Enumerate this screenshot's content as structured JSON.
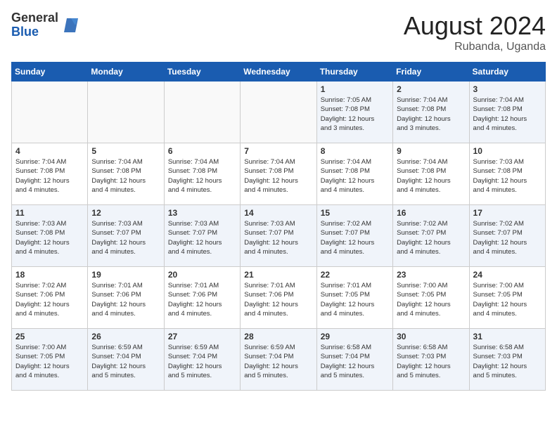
{
  "logo": {
    "general": "General",
    "blue": "Blue"
  },
  "title": {
    "month": "August 2024",
    "location": "Rubanda, Uganda"
  },
  "weekdays": [
    "Sunday",
    "Monday",
    "Tuesday",
    "Wednesday",
    "Thursday",
    "Friday",
    "Saturday"
  ],
  "weeks": [
    [
      {
        "day": "",
        "info": ""
      },
      {
        "day": "",
        "info": ""
      },
      {
        "day": "",
        "info": ""
      },
      {
        "day": "",
        "info": ""
      },
      {
        "day": "1",
        "info": "Sunrise: 7:05 AM\nSunset: 7:08 PM\nDaylight: 12 hours\nand 3 minutes."
      },
      {
        "day": "2",
        "info": "Sunrise: 7:04 AM\nSunset: 7:08 PM\nDaylight: 12 hours\nand 3 minutes."
      },
      {
        "day": "3",
        "info": "Sunrise: 7:04 AM\nSunset: 7:08 PM\nDaylight: 12 hours\nand 4 minutes."
      }
    ],
    [
      {
        "day": "4",
        "info": "Sunrise: 7:04 AM\nSunset: 7:08 PM\nDaylight: 12 hours\nand 4 minutes."
      },
      {
        "day": "5",
        "info": "Sunrise: 7:04 AM\nSunset: 7:08 PM\nDaylight: 12 hours\nand 4 minutes."
      },
      {
        "day": "6",
        "info": "Sunrise: 7:04 AM\nSunset: 7:08 PM\nDaylight: 12 hours\nand 4 minutes."
      },
      {
        "day": "7",
        "info": "Sunrise: 7:04 AM\nSunset: 7:08 PM\nDaylight: 12 hours\nand 4 minutes."
      },
      {
        "day": "8",
        "info": "Sunrise: 7:04 AM\nSunset: 7:08 PM\nDaylight: 12 hours\nand 4 minutes."
      },
      {
        "day": "9",
        "info": "Sunrise: 7:04 AM\nSunset: 7:08 PM\nDaylight: 12 hours\nand 4 minutes."
      },
      {
        "day": "10",
        "info": "Sunrise: 7:03 AM\nSunset: 7:08 PM\nDaylight: 12 hours\nand 4 minutes."
      }
    ],
    [
      {
        "day": "11",
        "info": "Sunrise: 7:03 AM\nSunset: 7:08 PM\nDaylight: 12 hours\nand 4 minutes."
      },
      {
        "day": "12",
        "info": "Sunrise: 7:03 AM\nSunset: 7:07 PM\nDaylight: 12 hours\nand 4 minutes."
      },
      {
        "day": "13",
        "info": "Sunrise: 7:03 AM\nSunset: 7:07 PM\nDaylight: 12 hours\nand 4 minutes."
      },
      {
        "day": "14",
        "info": "Sunrise: 7:03 AM\nSunset: 7:07 PM\nDaylight: 12 hours\nand 4 minutes."
      },
      {
        "day": "15",
        "info": "Sunrise: 7:02 AM\nSunset: 7:07 PM\nDaylight: 12 hours\nand 4 minutes."
      },
      {
        "day": "16",
        "info": "Sunrise: 7:02 AM\nSunset: 7:07 PM\nDaylight: 12 hours\nand 4 minutes."
      },
      {
        "day": "17",
        "info": "Sunrise: 7:02 AM\nSunset: 7:07 PM\nDaylight: 12 hours\nand 4 minutes."
      }
    ],
    [
      {
        "day": "18",
        "info": "Sunrise: 7:02 AM\nSunset: 7:06 PM\nDaylight: 12 hours\nand 4 minutes."
      },
      {
        "day": "19",
        "info": "Sunrise: 7:01 AM\nSunset: 7:06 PM\nDaylight: 12 hours\nand 4 minutes."
      },
      {
        "day": "20",
        "info": "Sunrise: 7:01 AM\nSunset: 7:06 PM\nDaylight: 12 hours\nand 4 minutes."
      },
      {
        "day": "21",
        "info": "Sunrise: 7:01 AM\nSunset: 7:06 PM\nDaylight: 12 hours\nand 4 minutes."
      },
      {
        "day": "22",
        "info": "Sunrise: 7:01 AM\nSunset: 7:05 PM\nDaylight: 12 hours\nand 4 minutes."
      },
      {
        "day": "23",
        "info": "Sunrise: 7:00 AM\nSunset: 7:05 PM\nDaylight: 12 hours\nand 4 minutes."
      },
      {
        "day": "24",
        "info": "Sunrise: 7:00 AM\nSunset: 7:05 PM\nDaylight: 12 hours\nand 4 minutes."
      }
    ],
    [
      {
        "day": "25",
        "info": "Sunrise: 7:00 AM\nSunset: 7:05 PM\nDaylight: 12 hours\nand 4 minutes."
      },
      {
        "day": "26",
        "info": "Sunrise: 6:59 AM\nSunset: 7:04 PM\nDaylight: 12 hours\nand 5 minutes."
      },
      {
        "day": "27",
        "info": "Sunrise: 6:59 AM\nSunset: 7:04 PM\nDaylight: 12 hours\nand 5 minutes."
      },
      {
        "day": "28",
        "info": "Sunrise: 6:59 AM\nSunset: 7:04 PM\nDaylight: 12 hours\nand 5 minutes."
      },
      {
        "day": "29",
        "info": "Sunrise: 6:58 AM\nSunset: 7:04 PM\nDaylight: 12 hours\nand 5 minutes."
      },
      {
        "day": "30",
        "info": "Sunrise: 6:58 AM\nSunset: 7:03 PM\nDaylight: 12 hours\nand 5 minutes."
      },
      {
        "day": "31",
        "info": "Sunrise: 6:58 AM\nSunset: 7:03 PM\nDaylight: 12 hours\nand 5 minutes."
      }
    ]
  ]
}
